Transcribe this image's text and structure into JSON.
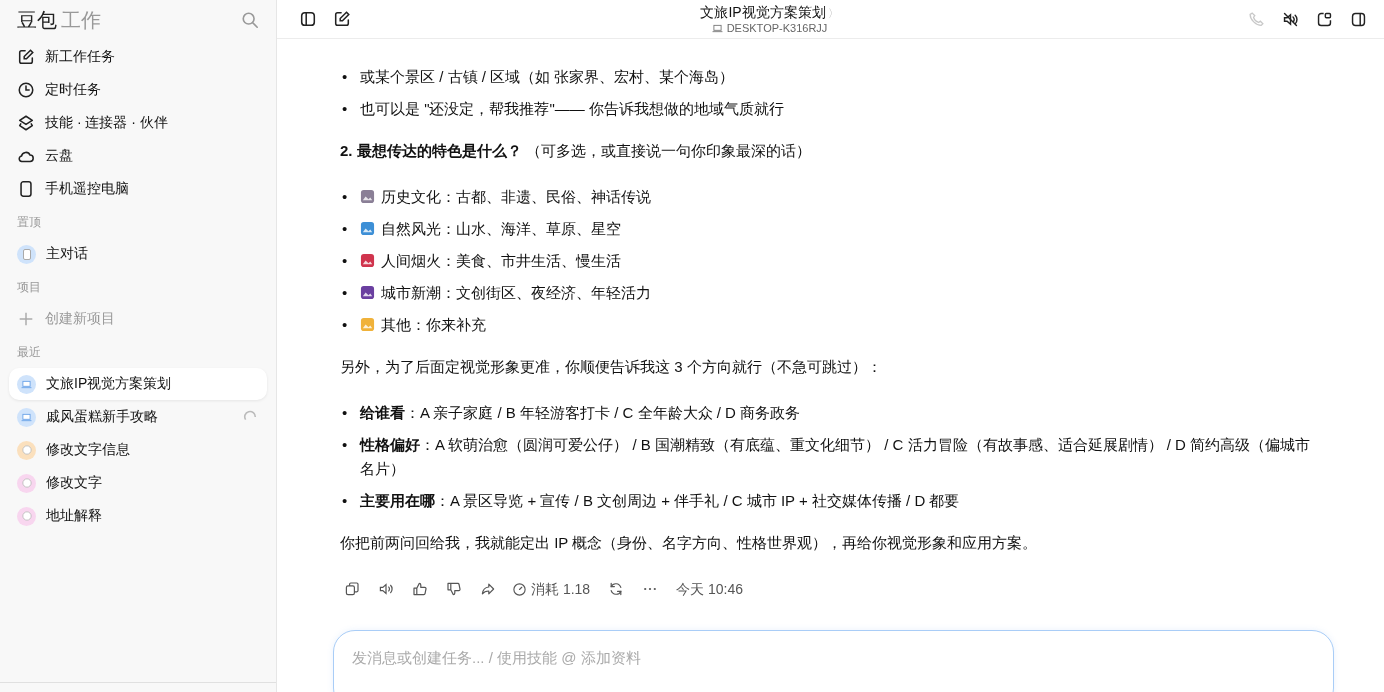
{
  "sidebar": {
    "brand": "豆包",
    "brand_suffix": "工作",
    "nav": [
      {
        "label": "新工作任务",
        "kind": "edit"
      },
      {
        "label": "定时任务",
        "kind": "clock"
      },
      {
        "label": "技能 · 连接器 · 伙伴",
        "kind": "layers"
      },
      {
        "label": "云盘",
        "kind": "cloud"
      },
      {
        "label": "手机遥控电脑",
        "kind": "phone"
      }
    ],
    "pinned_label": "置顶",
    "pinned": [
      {
        "label": "主对话",
        "color": "#cfe3fb"
      }
    ],
    "projects_label": "项目",
    "new_project": "创建新项目",
    "recent_label": "最近",
    "recent": [
      {
        "label": "文旅IP视觉方案策划",
        "kind": "laptop",
        "color": "#cfe3fb",
        "selected": true,
        "loading": false
      },
      {
        "label": "戚风蛋糕新手攻略",
        "kind": "laptop",
        "color": "#cfe3fb",
        "selected": false,
        "loading": true
      },
      {
        "label": "修改文字信息",
        "kind": "chat",
        "color": "#fbe0bd",
        "selected": false,
        "loading": false
      },
      {
        "label": "修改文字",
        "kind": "chat",
        "color": "#f8d6ef",
        "selected": false,
        "loading": false
      },
      {
        "label": "地址解释",
        "kind": "chat",
        "color": "#f8d6ef",
        "selected": false,
        "loading": false
      }
    ]
  },
  "header": {
    "title": "文旅IP视觉方案策划",
    "chevron": "〉",
    "device": "DESKTOP-K316RJJ"
  },
  "blocks": [
    {
      "kind": "bullets",
      "marker": "•",
      "items": [
        "或某个景区 / 古镇 / 区域（如 张家界、宏村、某个海岛）",
        "也可以是 \"还没定，帮我推荐\"—— 你告诉我想做的地域气质就行"
      ]
    },
    {
      "kind": "paragraph",
      "text": "**2. 最想传达的特色是什么？** （可多选，或直接说一句你印象最深的话）"
    },
    {
      "kind": "emoji_bullets",
      "marker": "•",
      "items": [
        "历史文化：古都、非遗、民俗、神话传说",
        "自然风光：山水、海洋、草原、星空",
        "人间烟火：美食、市井生活、慢生活",
        "城市新潮：文创街区、夜经济、年轻活力",
        "其他：你来补充"
      ]
    },
    {
      "kind": "paragraph",
      "text": "另外，为了后面定视觉形象更准，你顺便告诉我这 3 个方向就行（不急可跳过）："
    },
    {
      "kind": "bullets",
      "marker": "•",
      "items": [
        "**给谁看**：A 亲子家庭 / B 年轻游客打卡 / C 全年龄大众 / D 商务政务",
        "**性格偏好**：A 软萌治愈（圆润可爱公仔） / B 国潮精致（有底蕴、重文化细节） / C 活力冒险（有故事感、适合延展剧情） / D 简约高级（偏城市名片）",
        "**主要用在哪**：A 景区导览 + 宣传 / B 文创周边 + 伴手礼 / C 城市 IP + 社交媒体传播 / D 都要"
      ]
    },
    {
      "kind": "paragraph",
      "text": "你把前两问回给我，我就能定出 IP 概念（身份、名字方向、性格世界观），再给你视觉形象和应用方案。"
    }
  ],
  "actions": {
    "cost": "消耗 1.18",
    "time": "今天 10:46"
  },
  "composer": {
    "placeholder": "发消息或创建任务... / 使用技能 @ 添加资料"
  }
}
